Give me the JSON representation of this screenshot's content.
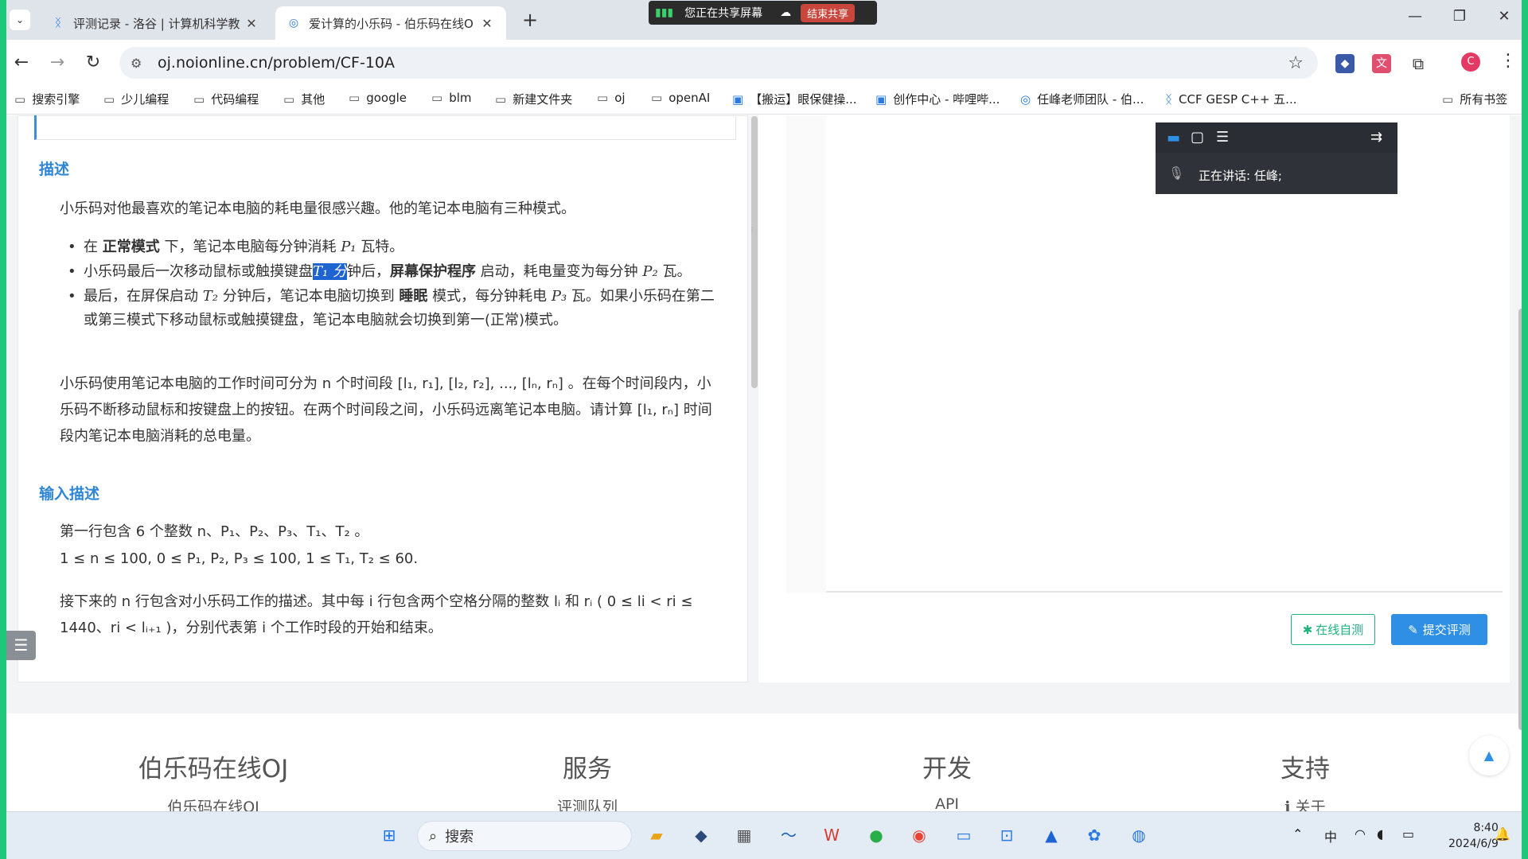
{
  "browser": {
    "tabs": [
      {
        "title": "评测记录 - 洛谷 | 计算机科学教",
        "close": "✕"
      },
      {
        "title": "爱计算的小乐码 - 伯乐码在线O",
        "close": "✕"
      }
    ],
    "new_tab": "+",
    "url": "oj.noionline.cn/problem/CF-10A",
    "share_banner": {
      "text": "您正在共享屏幕",
      "stop": "结束共享"
    },
    "bookmarks": [
      "搜索引擎",
      "少儿编程",
      "代码编程",
      "其他",
      "google",
      "blm",
      "新建文件夹",
      "oj",
      "openAI",
      "【搬运】眼保健操...",
      "创作中心 - 哔哩哔...",
      "任峰老师团队 - 伯...",
      "CCF GESP C++ 五...",
      "所有书签"
    ],
    "profile_letter": "C"
  },
  "problem": {
    "desc_heading": "描述",
    "desc_intro": "小乐码对他最喜欢的笔记本电脑的耗电量很感兴趣。他的笔记本电脑有三种模式。",
    "bullets": [
      {
        "pre": "在 ",
        "bold": "正常模式",
        "post": " 下，笔记本电脑每分钟消耗 ",
        "math": "P₁",
        "tail": " 瓦特。"
      },
      {
        "pre": "小乐码最后一次移动鼠标或触摸键盘",
        "hl": "T₁ 分",
        "mid": "钟后，",
        "bold": "屏幕保护程序",
        "post": " 启动，耗电量变为每分钟 ",
        "math": "P₂",
        "tail": " 瓦。"
      },
      {
        "pre": "最后，在屏保启动 ",
        "math1": "T₂",
        "mid": " 分钟后，笔记本电脑切换到 ",
        "bold": "睡眠",
        "post": " 模式，每分钟耗电 ",
        "math": "P₃",
        "tail": " 瓦。如果小乐码在第二或第三模式下移动鼠标或触摸键盘，笔记本电脑就会切换到第一(正常)模式。"
      }
    ],
    "desc_p2": "小乐码使用笔记本电脑的工作时间可分为 n 个时间段 [l₁, r₁], [l₂, r₂], ..., [lₙ, rₙ] 。在每个时间段内，小乐码不断移动鼠标和按键盘上的按钮。在两个时间段之间，小乐码远离笔记本电脑。请计算 [l₁, rₙ] 时间段内笔记本电脑消耗的总电量。",
    "input_heading": "输入描述",
    "input_line1": "第一行包含 6 个整数 n、P₁、P₂、P₃、T₁、T₂ 。",
    "input_line2": "1 ≤ n ≤ 100, 0 ≤ P₁, P₂, P₃ ≤ 100, 1 ≤ T₁, T₂ ≤ 60.",
    "input_p3": "接下来的 n 行包含对小乐码工作的描述。其中每 i 行包含两个空格分隔的整数 lᵢ 和 rᵢ ( 0 ≤ li < ri ≤ 1440、ri < lᵢ₊₁ )，分别代表第 i 个工作时段的开始和结束。"
  },
  "editor": {
    "test_button": "在线自测",
    "submit_button": "提交评测"
  },
  "meeting": {
    "speaking_label": "正在讲话:",
    "speaker": "任峰;"
  },
  "footer": {
    "cols": [
      {
        "heading": "伯乐码在线OJ",
        "link": "伯乐码在线OJ"
      },
      {
        "heading": "服务",
        "link": "评测队列"
      },
      {
        "heading": "开发",
        "link": "API"
      },
      {
        "heading": "支持",
        "link": "关于"
      }
    ]
  },
  "taskbar": {
    "search_label": "搜索",
    "ime": "中",
    "time": "8:40",
    "date": "2024/6/9"
  }
}
